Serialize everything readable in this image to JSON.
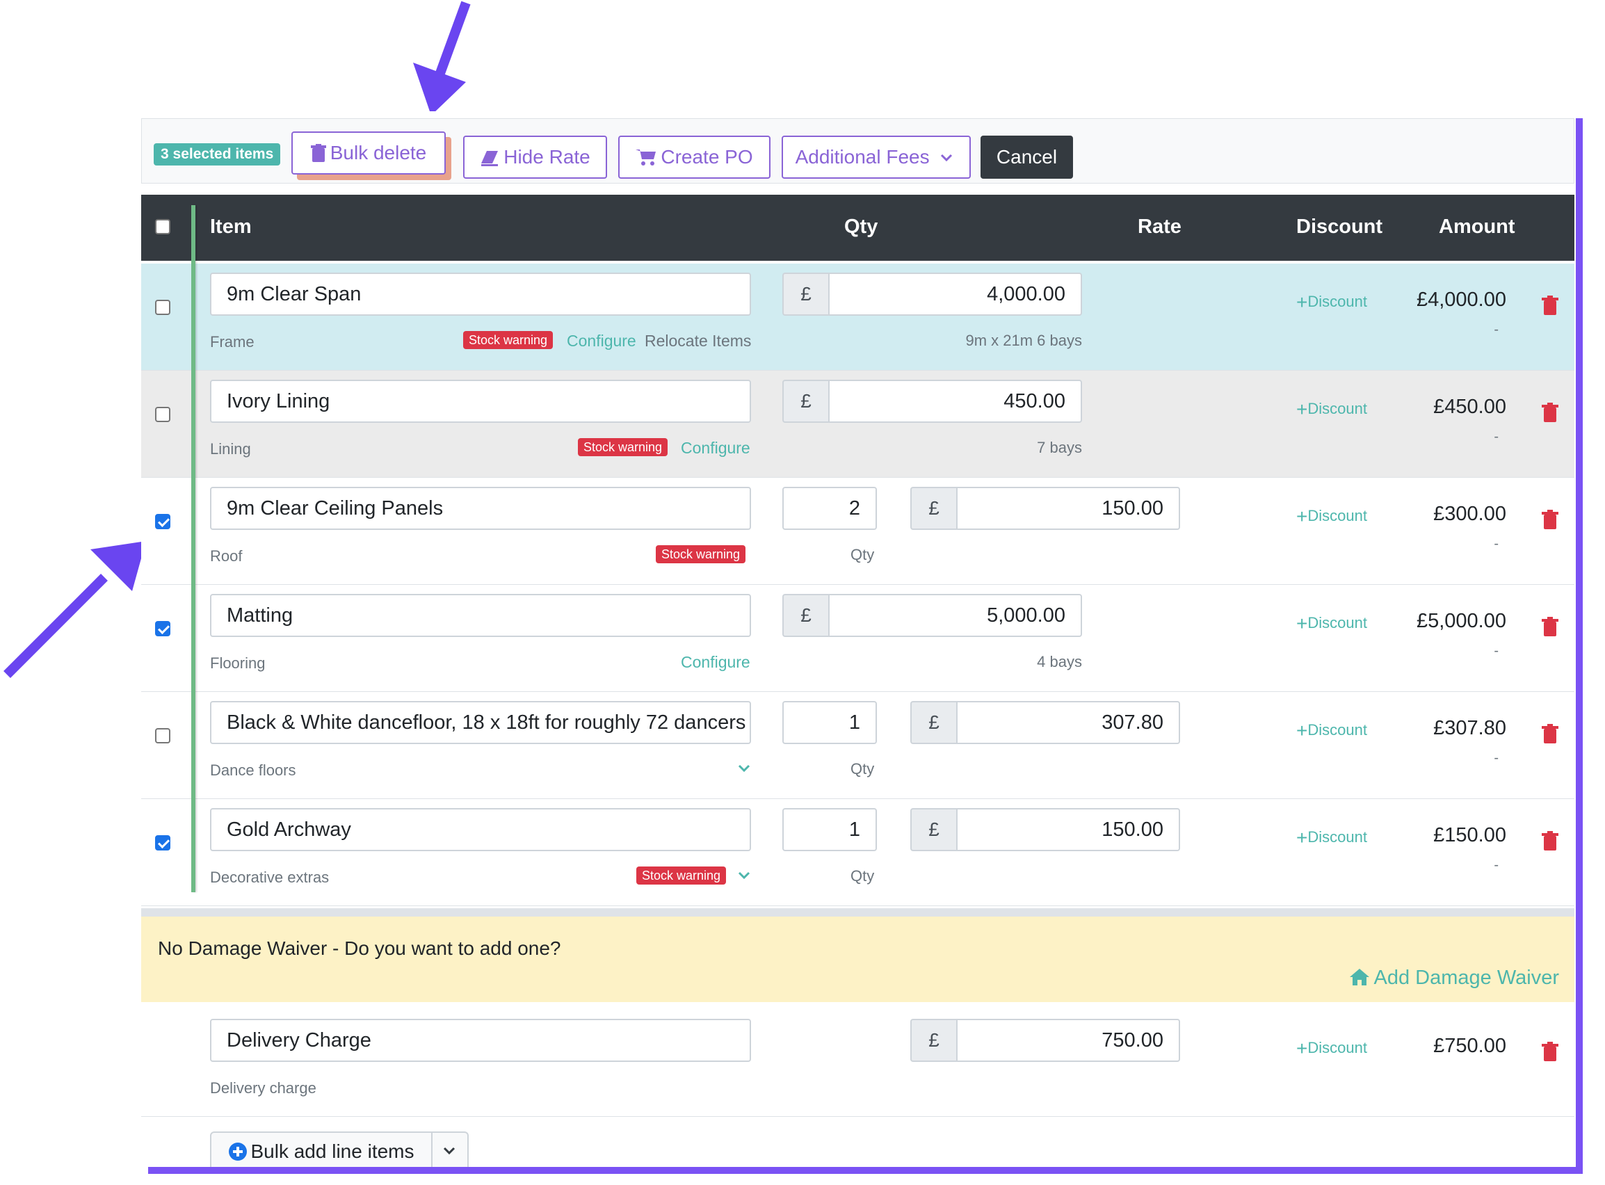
{
  "toolbar": {
    "selected_badge": "3 selected items",
    "bulk_delete": "Bulk delete",
    "hide_rate": "Hide Rate",
    "create_po": "Create PO",
    "additional_fees": "Additional Fees",
    "cancel": "Cancel"
  },
  "table": {
    "headers": {
      "item": "Item",
      "qty": "Qty",
      "rate": "Rate",
      "discount": "Discount",
      "amount": "Amount"
    },
    "rows": [
      {
        "name": "9m Clear Span",
        "category": "Frame",
        "stock_warning": "Stock warning",
        "configure": "Configure",
        "relocate": "Relocate Items",
        "currency": "£",
        "rate": "4,000.00",
        "rate_note": "9m x 21m 6 bays",
        "discount": "Discount",
        "amount": "£4,000.00",
        "amount_note": "-",
        "checked": false
      },
      {
        "name": "Ivory Lining",
        "category": "Lining",
        "stock_warning": "Stock warning",
        "configure": "Configure",
        "currency": "£",
        "rate": "450.00",
        "rate_note": "7 bays",
        "discount": "Discount",
        "amount": "£450.00",
        "amount_note": "-",
        "checked": false
      },
      {
        "name": "9m Clear Ceiling Panels",
        "category": "Roof",
        "stock_warning": "Stock warning",
        "qty": "2",
        "qty_label": "Qty",
        "currency": "£",
        "rate": "150.00",
        "discount": "Discount",
        "amount": "£300.00",
        "amount_note": "-",
        "checked": true
      },
      {
        "name": "Matting",
        "category": "Flooring",
        "configure": "Configure",
        "currency": "£",
        "rate": "5,000.00",
        "rate_note": "4 bays",
        "discount": "Discount",
        "amount": "£5,000.00",
        "amount_note": "-",
        "checked": true
      },
      {
        "name": "Black & White dancefloor, 18 x 18ft for roughly 72 dancers",
        "category": "Dance floors",
        "qty": "1",
        "qty_label": "Qty",
        "currency": "£",
        "rate": "307.80",
        "discount": "Discount",
        "amount": "£307.80",
        "amount_note": "-",
        "checked": false
      },
      {
        "name": "Gold Archway",
        "category": "Decorative extras",
        "stock_warning": "Stock warning",
        "qty": "1",
        "qty_label": "Qty",
        "currency": "£",
        "rate": "150.00",
        "discount": "Discount",
        "amount": "£150.00",
        "amount_note": "-",
        "checked": true
      }
    ]
  },
  "waiver": {
    "message": "No Damage Waiver - Do you want to add one?",
    "add_label": "Add Damage Waiver"
  },
  "delivery": {
    "name": "Delivery Charge",
    "category": "Delivery charge",
    "currency": "£",
    "rate": "750.00",
    "discount": "Discount",
    "amount": "£750.00"
  },
  "bulk_add": {
    "label": "Bulk add line items"
  },
  "colors": {
    "accent": "#8a64d6",
    "teal": "#4db6ac",
    "danger": "#dc3545",
    "annotation_arrow": "#6a45f0"
  },
  "icons": [
    "trash-icon",
    "eraser-icon",
    "cart-icon",
    "chevron-down-icon",
    "plus-icon",
    "home-icon",
    "plus-circle-icon"
  ]
}
